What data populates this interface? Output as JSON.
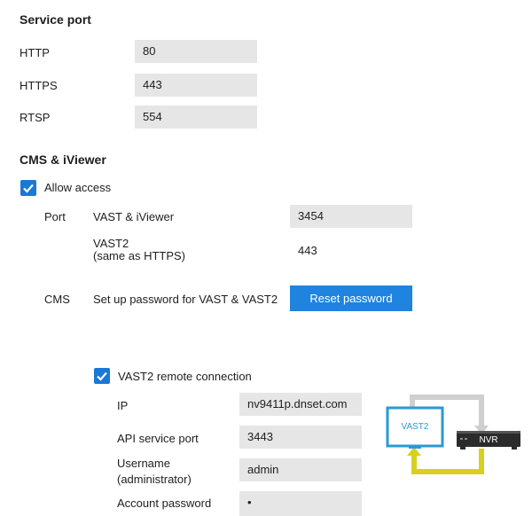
{
  "service_port": {
    "title": "Service port",
    "rows": [
      {
        "label": "HTTP",
        "value": "80"
      },
      {
        "label": "HTTPS",
        "value": "443"
      },
      {
        "label": "RTSP",
        "value": "554"
      }
    ]
  },
  "cms": {
    "title": "CMS & iViewer",
    "allow_access_label": "Allow access",
    "port_label": "Port",
    "vast_iviewer_label": "VAST & iViewer",
    "vast_iviewer_value": "3454",
    "vast2_label_line1": "VAST2",
    "vast2_label_line2": "(same as HTTPS)",
    "vast2_value": "443",
    "cms_label": "CMS",
    "setup_text": "Set up password for VAST & VAST2",
    "reset_button": "Reset password"
  },
  "remote": {
    "checkbox_label": "VAST2 remote connection",
    "ip_label": "IP",
    "ip_value": "nv9411p.dnset.com",
    "api_label": "API service port",
    "api_value": "3443",
    "username_label_line1": "Username",
    "username_label_line2": "(administrator)",
    "username_value": "admin",
    "password_label": "Account password",
    "password_value": "•"
  },
  "diagram": {
    "monitor_text": "VAST2",
    "nvr_text": "NVR",
    "colors": {
      "monitor": "#2a9ad6",
      "nvr": "#2b2b2b",
      "arrow_top": "#cfcfcf",
      "arrow_bottom": "#d8d020"
    }
  },
  "colors": {
    "accent": "#1a78d6",
    "field_bg": "#e6e6e6"
  }
}
